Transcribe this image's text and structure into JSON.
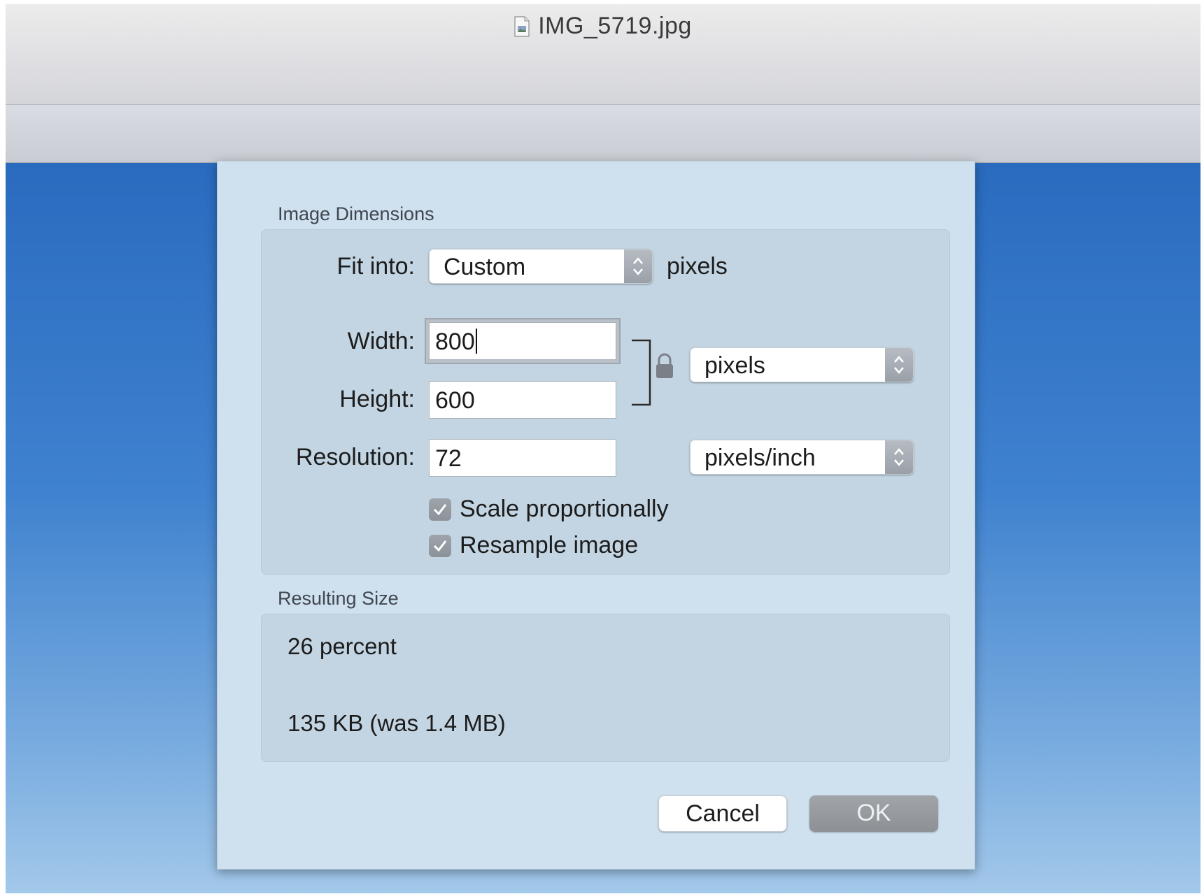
{
  "window": {
    "title": "IMG_5719.jpg",
    "title_icon": "jpeg-document-icon"
  },
  "dialog": {
    "image_dimensions": {
      "section_title": "Image Dimensions",
      "fit_into_label": "Fit into:",
      "fit_into_value": "Custom",
      "fit_into_unit": "pixels",
      "width_label": "Width:",
      "width_value": "800",
      "height_label": "Height:",
      "height_value": "600",
      "resolution_label": "Resolution:",
      "resolution_value": "72",
      "size_unit_value": "pixels",
      "resolution_unit_value": "pixels/inch",
      "lock_icon": "lock-icon",
      "scale_proportionally_label": "Scale proportionally",
      "scale_proportionally_checked": true,
      "resample_image_label": "Resample image",
      "resample_image_checked": true
    },
    "resulting_size": {
      "section_title": "Resulting Size",
      "percent_text": "26 percent",
      "size_text": "135 KB (was 1.4 MB)"
    },
    "buttons": {
      "cancel_label": "Cancel",
      "ok_label": "OK"
    }
  },
  "colors": {
    "sheet_background": "#cfe0ee",
    "photo_sky": "#3f82cf",
    "ok_button": "#969a9f"
  }
}
